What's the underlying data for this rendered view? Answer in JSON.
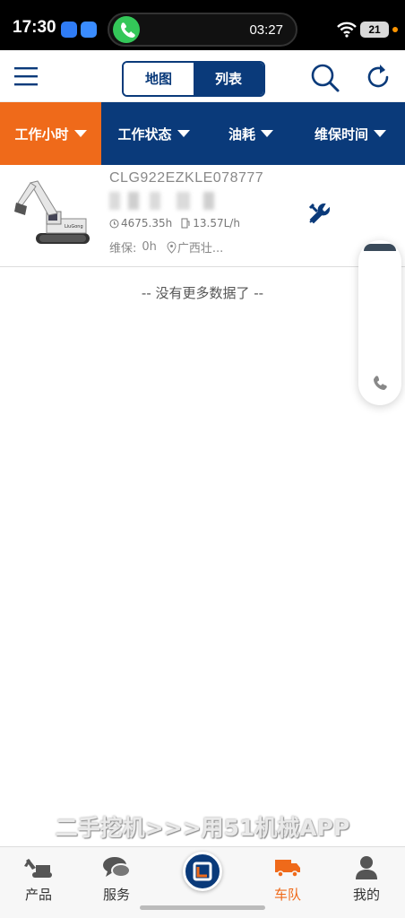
{
  "status_bar": {
    "time": "17:30",
    "call_timer": "03:27",
    "battery": "21"
  },
  "header": {
    "toggle": {
      "map_label": "地图",
      "list_label": "列表",
      "selected": "列表"
    }
  },
  "filters": [
    {
      "label": "工作小时",
      "active": true
    },
    {
      "label": "工作状态",
      "active": false
    },
    {
      "label": "油耗",
      "active": false
    },
    {
      "label": "维保时间",
      "active": false
    }
  ],
  "vehicle": {
    "serial": "CLG922EZKLE078777",
    "hours": "4675.35h",
    "fuel": "13.57L/h",
    "maintenance_label": "维保:",
    "maintenance_value": "0h",
    "location": "广西壮..."
  },
  "list_footer": "-- 没有更多数据了 --",
  "watermark": "二手挖机>>>用51机械APP",
  "tabbar": {
    "items": [
      {
        "label": "产品",
        "icon": "excavator-icon"
      },
      {
        "label": "服务",
        "icon": "chat-icon"
      },
      {
        "label": "",
        "icon": "logo-icon"
      },
      {
        "label": "车队",
        "icon": "truck-icon",
        "active": true
      },
      {
        "label": "我的",
        "icon": "user-icon"
      }
    ]
  },
  "colors": {
    "primary": "#0a3a7a",
    "accent": "#ef6a1a"
  }
}
